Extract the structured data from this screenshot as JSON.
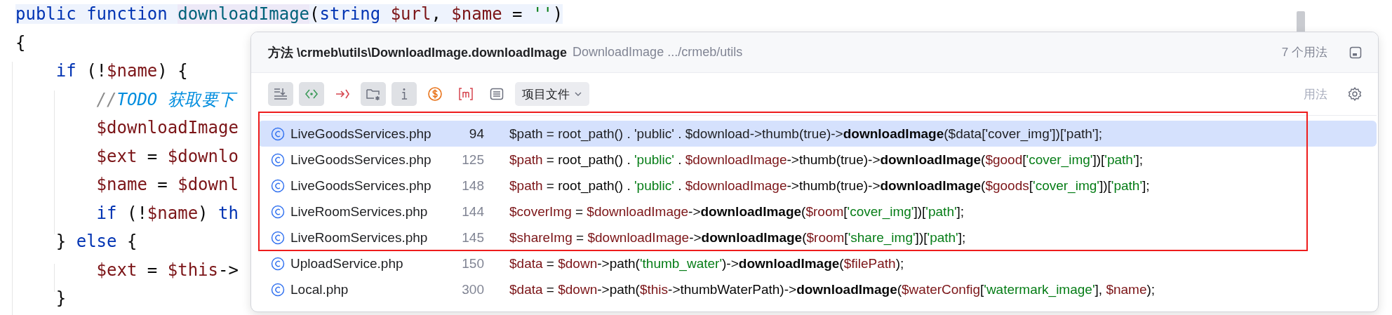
{
  "editor": {
    "lines": [
      {
        "highlighted": true,
        "tokens": [
          {
            "kind": "kw",
            "t": "public function "
          },
          {
            "kind": "fn",
            "t": "downloadImage"
          },
          {
            "kind": "plain",
            "t": "("
          },
          {
            "kind": "kw",
            "t": "string "
          },
          {
            "kind": "var",
            "t": "$url"
          },
          {
            "kind": "plain",
            "t": ", "
          },
          {
            "kind": "var",
            "t": "$name"
          },
          {
            "kind": "plain",
            "t": " = "
          },
          {
            "kind": "str",
            "t": "''"
          },
          {
            "kind": "plain",
            "t": ")"
          }
        ]
      },
      {
        "highlighted": false,
        "tokens": [
          {
            "kind": "plain",
            "t": "{"
          }
        ]
      },
      {
        "highlighted": false,
        "tokens": [
          {
            "kind": "kw",
            "t": "    if "
          },
          {
            "kind": "plain",
            "t": "(!"
          },
          {
            "kind": "var",
            "t": "$name"
          },
          {
            "kind": "plain",
            "t": ") {"
          }
        ]
      },
      {
        "highlighted": false,
        "tokens": [
          {
            "kind": "comment",
            "t": "        //"
          },
          {
            "kind": "todo",
            "t": "TODO 获取要下"
          }
        ]
      },
      {
        "highlighted": false,
        "tokens": [
          {
            "kind": "var",
            "t": "        $downloadImage"
          }
        ]
      },
      {
        "highlighted": false,
        "tokens": [
          {
            "kind": "var",
            "t": "        $ext"
          },
          {
            "kind": "plain",
            "t": " = "
          },
          {
            "kind": "var",
            "t": "$downlo"
          }
        ]
      },
      {
        "highlighted": false,
        "tokens": [
          {
            "kind": "var",
            "t": "        $name"
          },
          {
            "kind": "plain",
            "t": " = "
          },
          {
            "kind": "var",
            "t": "$downl"
          }
        ]
      },
      {
        "highlighted": false,
        "tokens": [
          {
            "kind": "kw",
            "t": "        if "
          },
          {
            "kind": "plain",
            "t": "(!"
          },
          {
            "kind": "var",
            "t": "$name"
          },
          {
            "kind": "plain",
            "t": ") "
          },
          {
            "kind": "kw",
            "t": "th"
          }
        ]
      },
      {
        "highlighted": false,
        "tokens": [
          {
            "kind": "plain",
            "t": "    } "
          },
          {
            "kind": "kw",
            "t": "else "
          },
          {
            "kind": "plain",
            "t": "{"
          }
        ]
      },
      {
        "highlighted": false,
        "tokens": [
          {
            "kind": "var",
            "t": "        $ext"
          },
          {
            "kind": "plain",
            "t": " = "
          },
          {
            "kind": "var",
            "t": "$this"
          },
          {
            "kind": "plain",
            "t": "->"
          }
        ]
      },
      {
        "highlighted": false,
        "tokens": [
          {
            "kind": "plain",
            "t": "    }"
          }
        ]
      }
    ]
  },
  "popup": {
    "header": {
      "title": "方法 \\crmeb\\utils\\DownloadImage.downloadImage",
      "subtitle": "DownloadImage .../crmeb/utils",
      "count": "7 个用法"
    },
    "filters": [
      {
        "kind": "flatten",
        "selected": true
      },
      {
        "kind": "read-write",
        "selected": true
      },
      {
        "kind": "import",
        "selected": false
      },
      {
        "kind": "directory",
        "selected": true
      },
      {
        "kind": "info",
        "selected": true
      },
      {
        "kind": "dollar",
        "selected": false
      },
      {
        "kind": "module",
        "selected": false
      },
      {
        "kind": "list",
        "selected": false
      }
    ],
    "scope": "项目文件",
    "usages_label": "用法",
    "usages": [
      {
        "file": "LiveGoodsServices.php",
        "line": "94",
        "selected": true,
        "outlined": true,
        "tokens": [
          {
            "kind": "var",
            "t": "$path"
          },
          {
            "kind": "plain",
            "t": " = root_path() . "
          },
          {
            "kind": "str",
            "t": "'public'"
          },
          {
            "kind": "plain",
            "t": " . "
          },
          {
            "kind": "var",
            "t": "$download"
          },
          {
            "kind": "plain",
            "t": "->thumb(true)->"
          },
          {
            "kind": "call",
            "t": "downloadImage"
          },
          {
            "kind": "plain",
            "t": "("
          },
          {
            "kind": "var",
            "t": "$data"
          },
          {
            "kind": "plain",
            "t": "["
          },
          {
            "kind": "str",
            "t": "'cover_img'"
          },
          {
            "kind": "plain",
            "t": "])["
          },
          {
            "kind": "str",
            "t": "'path'"
          },
          {
            "kind": "plain",
            "t": "];"
          }
        ]
      },
      {
        "file": "LiveGoodsServices.php",
        "line": "125",
        "selected": false,
        "outlined": true,
        "tokens": [
          {
            "kind": "var",
            "t": "$path"
          },
          {
            "kind": "plain",
            "t": " = root_path() . "
          },
          {
            "kind": "str",
            "t": "'public'"
          },
          {
            "kind": "plain",
            "t": " . "
          },
          {
            "kind": "var",
            "t": "$downloadImage"
          },
          {
            "kind": "plain",
            "t": "->thumb(true)->"
          },
          {
            "kind": "call",
            "t": "downloadImage"
          },
          {
            "kind": "plain",
            "t": "("
          },
          {
            "kind": "var",
            "t": "$good"
          },
          {
            "kind": "plain",
            "t": "["
          },
          {
            "kind": "str",
            "t": "'cover_img'"
          },
          {
            "kind": "plain",
            "t": "])["
          },
          {
            "kind": "str",
            "t": "'path'"
          },
          {
            "kind": "plain",
            "t": "];"
          }
        ]
      },
      {
        "file": "LiveGoodsServices.php",
        "line": "148",
        "selected": false,
        "outlined": true,
        "tokens": [
          {
            "kind": "var",
            "t": "$path"
          },
          {
            "kind": "plain",
            "t": " = root_path() . "
          },
          {
            "kind": "str",
            "t": "'public'"
          },
          {
            "kind": "plain",
            "t": " . "
          },
          {
            "kind": "var",
            "t": "$downloadImage"
          },
          {
            "kind": "plain",
            "t": "->thumb(true)->"
          },
          {
            "kind": "call",
            "t": "downloadImage"
          },
          {
            "kind": "plain",
            "t": "("
          },
          {
            "kind": "var",
            "t": "$goods"
          },
          {
            "kind": "plain",
            "t": "["
          },
          {
            "kind": "str",
            "t": "'cover_img'"
          },
          {
            "kind": "plain",
            "t": "])["
          },
          {
            "kind": "str",
            "t": "'path'"
          },
          {
            "kind": "plain",
            "t": "];"
          }
        ]
      },
      {
        "file": "LiveRoomServices.php",
        "line": "144",
        "selected": false,
        "outlined": true,
        "tokens": [
          {
            "kind": "var",
            "t": "$coverImg"
          },
          {
            "kind": "plain",
            "t": " = "
          },
          {
            "kind": "var",
            "t": "$downloadImage"
          },
          {
            "kind": "plain",
            "t": "->"
          },
          {
            "kind": "call",
            "t": "downloadImage"
          },
          {
            "kind": "plain",
            "t": "("
          },
          {
            "kind": "var",
            "t": "$room"
          },
          {
            "kind": "plain",
            "t": "["
          },
          {
            "kind": "str",
            "t": "'cover_img'"
          },
          {
            "kind": "plain",
            "t": "])["
          },
          {
            "kind": "str",
            "t": "'path'"
          },
          {
            "kind": "plain",
            "t": "];"
          }
        ]
      },
      {
        "file": "LiveRoomServices.php",
        "line": "145",
        "selected": false,
        "outlined": true,
        "tokens": [
          {
            "kind": "var",
            "t": "$shareImg"
          },
          {
            "kind": "plain",
            "t": " = "
          },
          {
            "kind": "var",
            "t": "$downloadImage"
          },
          {
            "kind": "plain",
            "t": "->"
          },
          {
            "kind": "call",
            "t": "downloadImage"
          },
          {
            "kind": "plain",
            "t": "("
          },
          {
            "kind": "var",
            "t": "$room"
          },
          {
            "kind": "plain",
            "t": "["
          },
          {
            "kind": "str",
            "t": "'share_img'"
          },
          {
            "kind": "plain",
            "t": "])["
          },
          {
            "kind": "str",
            "t": "'path'"
          },
          {
            "kind": "plain",
            "t": "];"
          }
        ]
      },
      {
        "file": "UploadService.php",
        "line": "150",
        "selected": false,
        "outlined": false,
        "tokens": [
          {
            "kind": "var",
            "t": "$data"
          },
          {
            "kind": "plain",
            "t": " = "
          },
          {
            "kind": "var",
            "t": "$down"
          },
          {
            "kind": "plain",
            "t": "->path("
          },
          {
            "kind": "str",
            "t": "'thumb_water'"
          },
          {
            "kind": "plain",
            "t": ")->"
          },
          {
            "kind": "call",
            "t": "downloadImage"
          },
          {
            "kind": "plain",
            "t": "("
          },
          {
            "kind": "var",
            "t": "$filePath"
          },
          {
            "kind": "plain",
            "t": ");"
          }
        ]
      },
      {
        "file": "Local.php",
        "line": "300",
        "selected": false,
        "outlined": false,
        "tokens": [
          {
            "kind": "var",
            "t": "$data"
          },
          {
            "kind": "plain",
            "t": " = "
          },
          {
            "kind": "var",
            "t": "$down"
          },
          {
            "kind": "plain",
            "t": "->path("
          },
          {
            "kind": "var",
            "t": "$this"
          },
          {
            "kind": "plain",
            "t": "->thumbWaterPath)->"
          },
          {
            "kind": "call",
            "t": "downloadImage"
          },
          {
            "kind": "plain",
            "t": "("
          },
          {
            "kind": "var",
            "t": "$waterConfig"
          },
          {
            "kind": "plain",
            "t": "["
          },
          {
            "kind": "str",
            "t": "'watermark_image'"
          },
          {
            "kind": "plain",
            "t": "], "
          },
          {
            "kind": "var",
            "t": "$name"
          },
          {
            "kind": "plain",
            "t": ");"
          }
        ]
      }
    ]
  }
}
